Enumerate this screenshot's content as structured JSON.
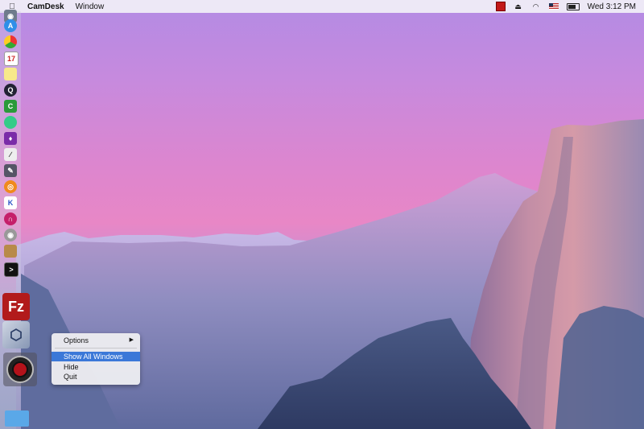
{
  "menubar": {
    "app_name": "CamDesk",
    "menu_window": "Window",
    "clock": "Wed 3:12 PM"
  },
  "context_menu": {
    "items": [
      "Options",
      "Show All Windows",
      "Hide",
      "Quit"
    ],
    "submenu_arrow": "▶"
  },
  "dock": {
    "icons": [
      "camera-icon",
      "app-store-icon",
      "chrome-icon",
      "calendar-icon",
      "notes-icon",
      "quicktime-icon",
      "camtasia-icon",
      "maps-icon",
      "paint-icon",
      "grapher-icon",
      "photo-icon",
      "blender-icon",
      "k-icon",
      "headphones-icon",
      "disk-utility-icon",
      "stamp-icon",
      "terminal-icon",
      "filezilla-icon",
      "virtualbox-icon",
      "camdesk-icon",
      "folder-icon"
    ],
    "calendar_day": "17",
    "filezilla_label": "Fz",
    "k_label": "K"
  },
  "colors": {
    "highlight": "#3b78d8",
    "record_red": "#c21818"
  }
}
